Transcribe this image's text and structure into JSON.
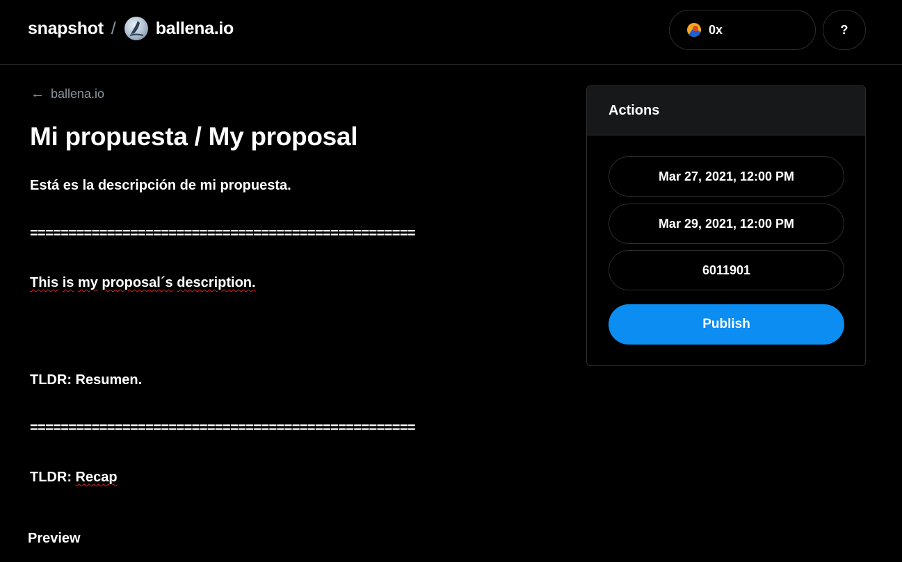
{
  "header": {
    "app_name": "snapshot",
    "separator": "/",
    "space_name": "ballena.io",
    "account_address": "0x",
    "help_label": "?"
  },
  "back_link": {
    "label": "ballena.io"
  },
  "proposal": {
    "title": "Mi propuesta / My proposal",
    "lines": {
      "es_description": "Está es la descripción de mi propuesta.",
      "separator_1": "==================================================",
      "en_description_words": [
        "This",
        "is",
        "my",
        "proposal´s",
        "description."
      ],
      "tldr_es": "TLDR: Resumen.",
      "separator_2": "==================================================",
      "tldr_en_prefix": "TLDR:",
      "tldr_en_word": "Recap"
    },
    "preview_label": "Preview"
  },
  "actions": {
    "title": "Actions",
    "start_date": "Mar 27, 2021, 12:00 PM",
    "end_date": "Mar 29, 2021, 12:00 PM",
    "snapshot_block": "6011901",
    "publish_label": "Publish"
  },
  "colors": {
    "background": "#000000",
    "border": "#2d2d2d",
    "muted_text": "#8b949e",
    "accent": "#0b8df2",
    "panel_header": "#17181a"
  }
}
